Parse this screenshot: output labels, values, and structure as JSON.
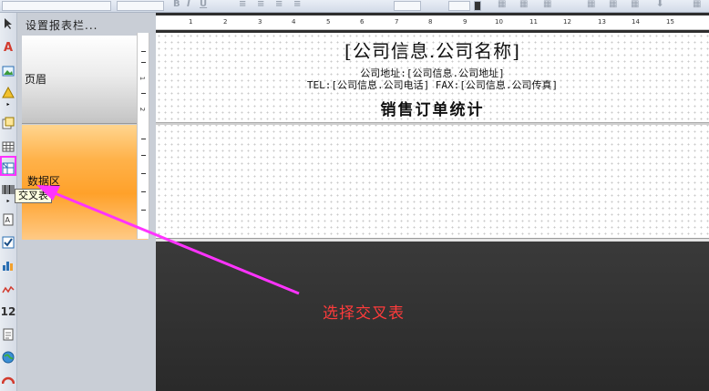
{
  "band_panel": {
    "title": "设置报表栏...",
    "bands": [
      {
        "label": "页眉"
      },
      {
        "label": "数据区"
      }
    ]
  },
  "left_toolbar": {
    "tools": [
      "pointer-icon",
      "text-icon",
      "image-icon",
      "shape-icon",
      "subreport-icon",
      "table-icon",
      "crosstab-icon",
      "barcode-icon",
      "label-icon",
      "checkbox-icon",
      "chart-icon",
      "sparkline-icon",
      "number-icon",
      "document-icon",
      "globe-icon",
      "gauge-icon"
    ],
    "tooltip": "交叉表"
  },
  "ruler": {
    "horizontal": [
      "1",
      "2",
      "3",
      "4",
      "5",
      "6",
      "7",
      "8",
      "9",
      "10",
      "11",
      "12",
      "13",
      "14",
      "15"
    ],
    "vertical": [
      "1",
      "2"
    ]
  },
  "report": {
    "company_name": "[公司信息.公司名称]",
    "address_line": "公司地址:[公司信息.公司地址]",
    "contact_line": "TEL:[公司信息.公司电话]  FAX:[公司信息.公司传真]",
    "title": "销售订单统计"
  },
  "annotation": {
    "text": "选择交叉表",
    "color": "#ff3b3b",
    "highlight_color": "#ff33ff"
  }
}
